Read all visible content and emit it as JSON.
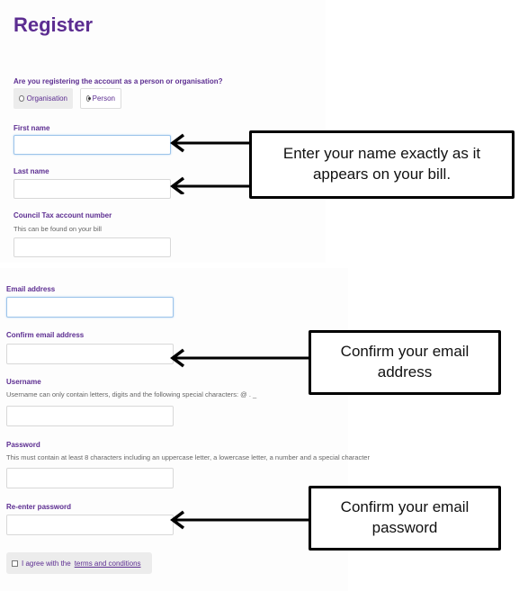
{
  "page": {
    "title": "Register"
  },
  "account_type": {
    "question": "Are you registering the account as a person or organisation?",
    "options": [
      {
        "label": "Organisation",
        "selected": false
      },
      {
        "label": "Person",
        "selected": true
      }
    ]
  },
  "fields": {
    "first_name": {
      "label": "First name",
      "value": ""
    },
    "last_name": {
      "label": "Last name",
      "value": ""
    },
    "council_tax": {
      "label": "Council Tax account number",
      "hint": "This can be found on your bill",
      "value": ""
    },
    "email": {
      "label": "Email address",
      "value": ""
    },
    "confirm_email": {
      "label": "Confirm email address",
      "value": ""
    },
    "username": {
      "label": "Username",
      "hint": "Username can only contain letters, digits and the following special characters: @ . _",
      "value": ""
    },
    "password": {
      "label": "Password",
      "hint": "This must contain at least 8 characters including an uppercase letter, a lowercase letter, a number and a special character",
      "value": ""
    },
    "reenter_password": {
      "label": "Re-enter password",
      "value": ""
    }
  },
  "agree": {
    "prefix": "I agree with the",
    "link": "terms and conditions",
    "checked": false
  },
  "callouts": {
    "name": "Enter your name exactly as it appears on your bill.",
    "email": "Confirm your email address",
    "password": "Confirm your email password"
  },
  "colors": {
    "brand_purple": "#5c2d91",
    "focus_border": "#9cc4ea"
  }
}
